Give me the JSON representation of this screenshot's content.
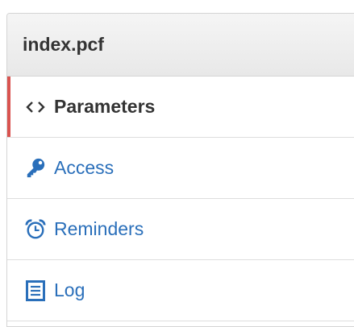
{
  "panel": {
    "title": "index.pcf"
  },
  "nav": {
    "items": [
      {
        "label": "Parameters",
        "icon": "code-icon",
        "active": true
      },
      {
        "label": "Access",
        "icon": "key-icon",
        "active": false
      },
      {
        "label": "Reminders",
        "icon": "alarm-clock-icon",
        "active": false
      },
      {
        "label": "Log",
        "icon": "list-document-icon",
        "active": false
      }
    ]
  },
  "colors": {
    "accent": "#d9534f",
    "link": "#2a6fba",
    "text": "#333333"
  }
}
